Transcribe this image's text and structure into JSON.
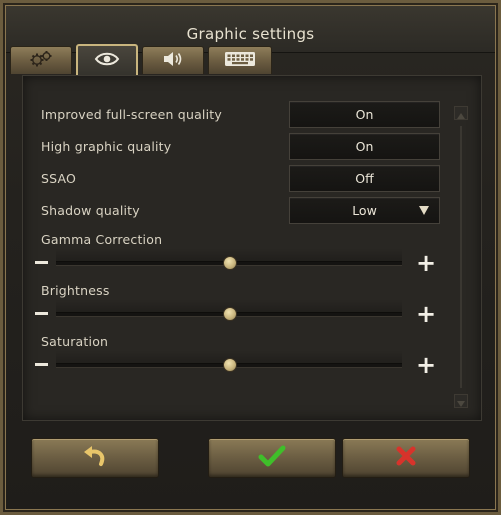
{
  "window": {
    "title": "Graphic settings"
  },
  "tabs": [
    {
      "icon": "gears-icon",
      "active": false
    },
    {
      "icon": "eye-icon",
      "active": true
    },
    {
      "icon": "speaker-icon",
      "active": false
    },
    {
      "icon": "keyboard-icon",
      "active": false
    }
  ],
  "settings": {
    "improved_fullscreen": {
      "label": "Improved full-screen quality",
      "value": "On"
    },
    "high_graphic": {
      "label": "High graphic quality",
      "value": "On"
    },
    "ssao": {
      "label": "SSAO",
      "value": "Off"
    },
    "shadow": {
      "label": "Shadow quality",
      "value": "Low"
    }
  },
  "sliders": {
    "gamma": {
      "label": "Gamma Correction",
      "value": 0.5
    },
    "brightness": {
      "label": "Brightness",
      "value": 0.5
    },
    "saturation": {
      "label": "Saturation",
      "value": 0.5
    }
  },
  "buttons": {
    "reset": {
      "icon": "undo-icon"
    },
    "confirm": {
      "icon": "checkmark-icon"
    },
    "cancel": {
      "icon": "close-icon"
    }
  },
  "colors": {
    "accent_gold": "#c9b57e",
    "confirm_green": "#3fbf2a",
    "cancel_red": "#d8332b"
  }
}
